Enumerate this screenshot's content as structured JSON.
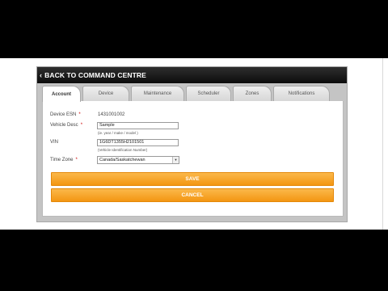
{
  "header": {
    "back_label": "BACK TO COMMAND CENTRE"
  },
  "tabs": [
    {
      "label": "Account",
      "active": true
    },
    {
      "label": "Device"
    },
    {
      "label": "Maintenance"
    },
    {
      "label": "Scheduler"
    },
    {
      "label": "Zones"
    },
    {
      "label": "Notifications"
    }
  ],
  "form": {
    "device_esn": {
      "label": "Device ESN",
      "required_mark": "*",
      "value": "1431001002"
    },
    "vehicle_desc": {
      "label": "Vehicle Desc",
      "required_mark": "*",
      "value": "Sample",
      "hint": "(ie. year / make / model )"
    },
    "vin": {
      "label": "VIN",
      "value": "1G6DT1355H2101501",
      "hint": "(Vehicle Identification Number)"
    },
    "time_zone": {
      "label": "Time Zone",
      "required_mark": "*",
      "value": "Canada/Saskatchewan"
    }
  },
  "buttons": {
    "save": "SAVE",
    "cancel": "CANCEL"
  },
  "colors": {
    "accent": "#f5a21f",
    "header": "#111111",
    "required": "#cc0000"
  },
  "icons": {
    "back": "chevron-left-icon",
    "select": "chevron-down-icon"
  }
}
